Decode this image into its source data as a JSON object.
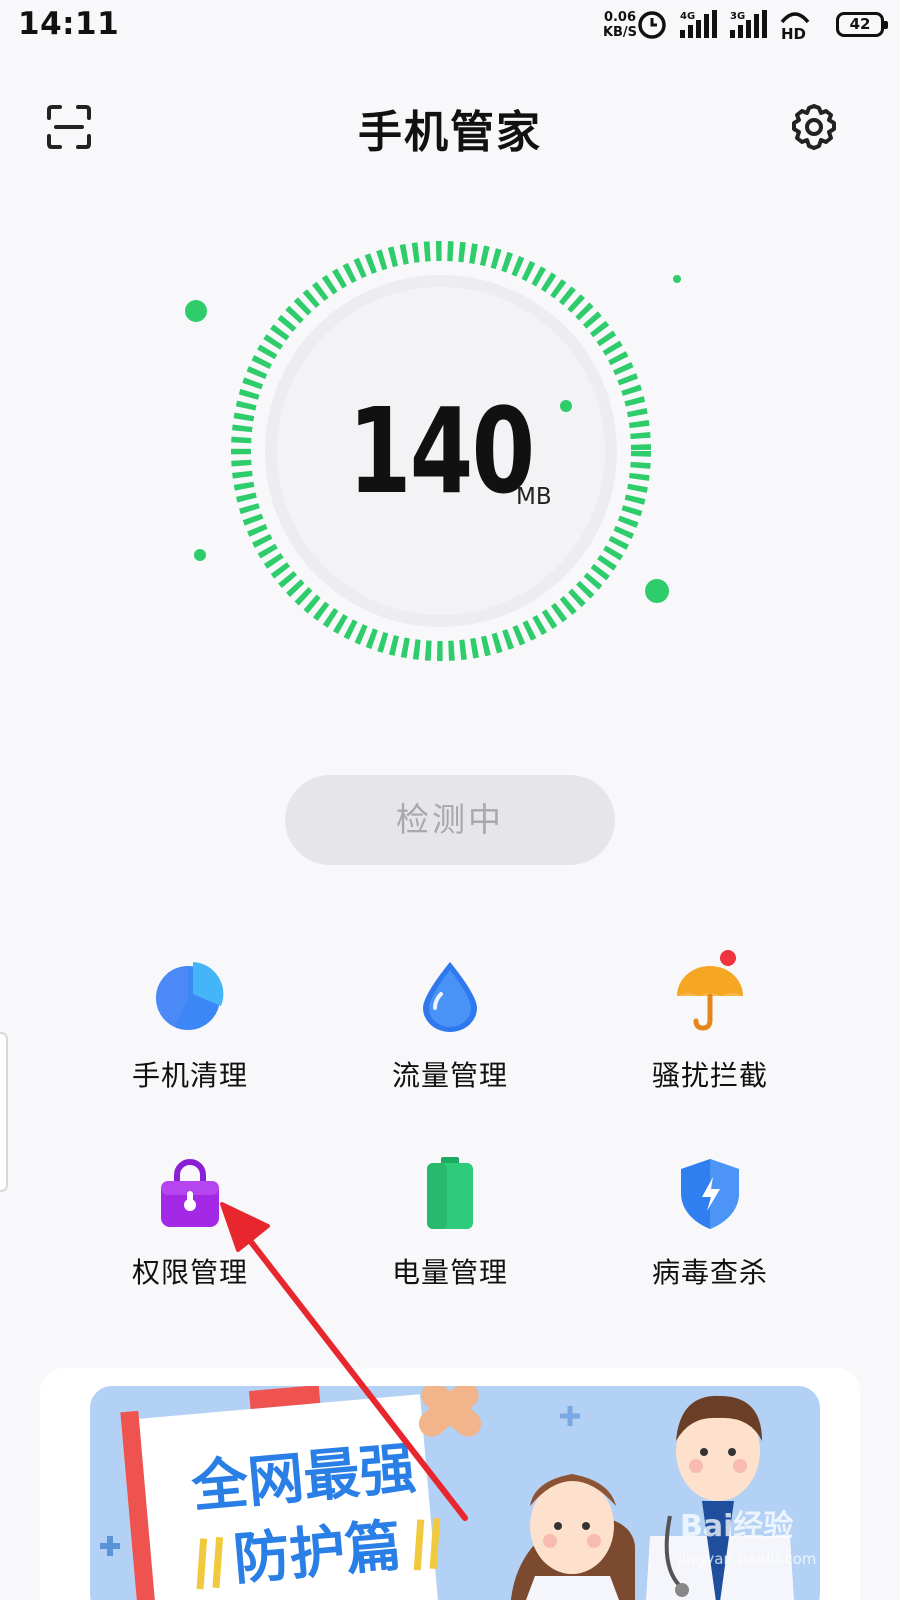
{
  "status_bar": {
    "time": "14:11",
    "net_speed_value": "0.06",
    "net_speed_unit": "KB/S",
    "signal1_label": "4G",
    "signal2_label": "3G",
    "hd_label": "HD",
    "battery_level": "42"
  },
  "header": {
    "title": "手机管家",
    "left_icon": "scan-icon",
    "right_icon": "gear-icon"
  },
  "gauge": {
    "value": "140",
    "unit": "MB",
    "progress": 1.0,
    "accent_color": "#2ecc6a"
  },
  "scan_button": {
    "label": "检测中"
  },
  "tools": [
    {
      "label": "手机清理",
      "icon": "pie-chart-icon"
    },
    {
      "label": "流量管理",
      "icon": "water-drop-icon"
    },
    {
      "label": "骚扰拦截",
      "icon": "umbrella-icon",
      "badge": true
    },
    {
      "label": "权限管理",
      "icon": "lock-bag-icon"
    },
    {
      "label": "电量管理",
      "icon": "battery-icon"
    },
    {
      "label": "病毒查杀",
      "icon": "shield-icon"
    }
  ],
  "banner": {
    "line1": "全网最强",
    "line2": "防护篇"
  },
  "watermark": {
    "brand": "Bai经验",
    "url": "jingyan.baidu.com"
  },
  "colors": {
    "background": "#f8f7fa",
    "gauge_green": "#2ecc6a",
    "annotation_red": "#e8262e"
  }
}
